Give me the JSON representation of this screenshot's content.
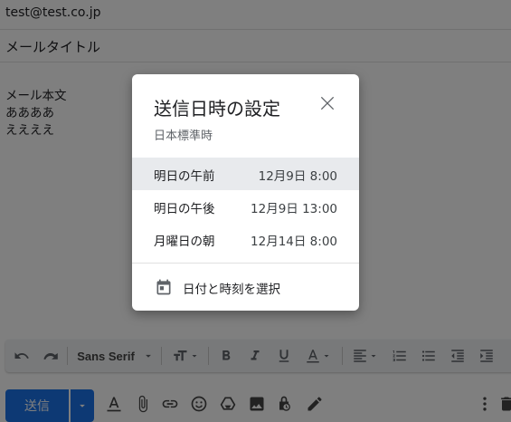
{
  "compose": {
    "to": "test@test.co.jp",
    "subject": "メールタイトル",
    "body_lines": [
      "メール本文",
      "ああああ",
      "ええええ"
    ]
  },
  "toolbar": {
    "font_name": "Sans Serif",
    "icons": [
      "undo-icon",
      "redo-icon",
      "font-dropdown",
      "text-size-icon",
      "bold-icon",
      "italic-icon",
      "underline-icon",
      "text-color-icon",
      "align-icon",
      "numbered-list-icon",
      "bulleted-list-icon",
      "indent-less-icon",
      "indent-more-icon"
    ]
  },
  "bottom_bar": {
    "send_label": "送信",
    "icons": [
      "formatting-icon",
      "attach-icon",
      "link-icon",
      "emoji-icon",
      "drive-icon",
      "photo-icon",
      "confidential-icon",
      "signature-icon",
      "more-options-icon",
      "trash-icon"
    ]
  },
  "schedule_dialog": {
    "title": "送信日時の設定",
    "timezone": "日本標準時",
    "options": [
      {
        "label": "明日の午前",
        "time": "12月9日 8:00",
        "selected": true
      },
      {
        "label": "明日の午後",
        "time": "12月9日 13:00",
        "selected": false
      },
      {
        "label": "月曜日の朝",
        "time": "12月14日 8:00",
        "selected": false
      }
    ],
    "pick_label": "日付と時刻を選択"
  },
  "colors": {
    "accent": "#1a73e8",
    "overlay": "rgba(0,0,0,0.5)",
    "selected_row": "#e8eaed"
  }
}
